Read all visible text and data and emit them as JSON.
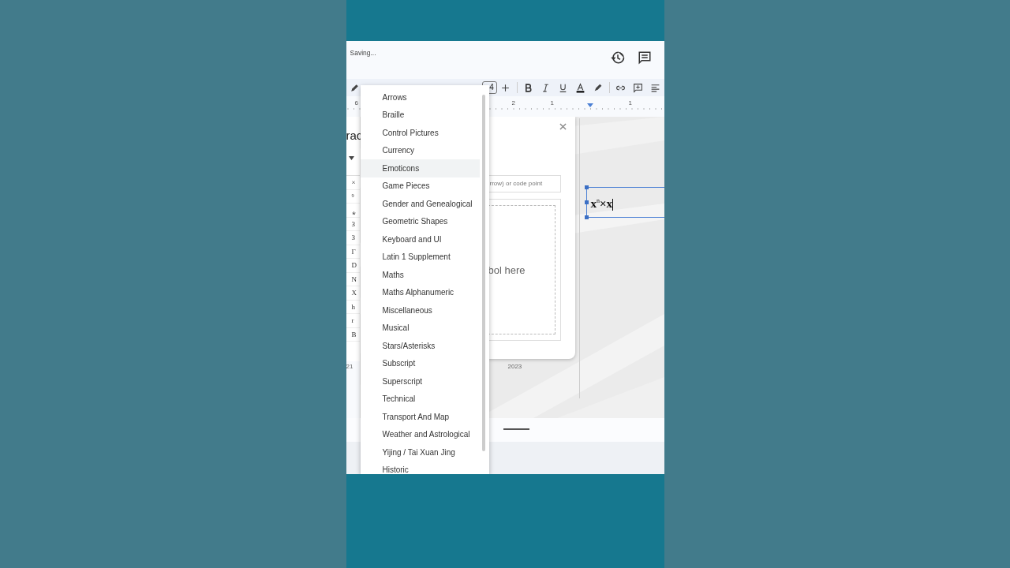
{
  "header": {
    "status": "Saving..."
  },
  "toolbar": {
    "font_size": "4"
  },
  "ruler": {
    "labels": [
      "6",
      "2",
      "1",
      "1"
    ]
  },
  "panel": {
    "title": "rac",
    "glyphs": [
      "×",
      "⁹",
      "⁎",
      "З",
      "З",
      "Γ",
      "D",
      "N",
      "X",
      "h",
      "r",
      "B"
    ]
  },
  "dialog": {
    "search_placeholder": "rrow) or code point",
    "draw_hint": "bol here"
  },
  "timeline": {
    "labels": [
      "21",
      "2023"
    ]
  },
  "slide": {
    "text_box": "x$^{n}$×x"
  },
  "menu": {
    "items": [
      {
        "label": "Arrows",
        "selected": false
      },
      {
        "label": "Braille",
        "selected": false
      },
      {
        "label": "Control Pictures",
        "selected": false
      },
      {
        "label": "Currency",
        "selected": false
      },
      {
        "label": "Emoticons",
        "selected": true
      },
      {
        "label": "Game Pieces",
        "selected": false
      },
      {
        "label": "Gender and Genealogical",
        "selected": false
      },
      {
        "label": "Geometric Shapes",
        "selected": false
      },
      {
        "label": "Keyboard and UI",
        "selected": false
      },
      {
        "label": "Latin 1 Supplement",
        "selected": false
      },
      {
        "label": "Maths",
        "selected": false
      },
      {
        "label": "Maths Alphanumeric",
        "selected": false
      },
      {
        "label": "Miscellaneous",
        "selected": false
      },
      {
        "label": "Musical",
        "selected": false
      },
      {
        "label": "Stars/Asterisks",
        "selected": false
      },
      {
        "label": "Subscript",
        "selected": false
      },
      {
        "label": "Superscript",
        "selected": false
      },
      {
        "label": "Technical",
        "selected": false
      },
      {
        "label": "Transport And Map",
        "selected": false
      },
      {
        "label": "Weather and Astrological",
        "selected": false
      },
      {
        "label": "Yijing / Tai Xuan Jing",
        "selected": false
      },
      {
        "label": "Historic",
        "selected": false
      }
    ]
  }
}
